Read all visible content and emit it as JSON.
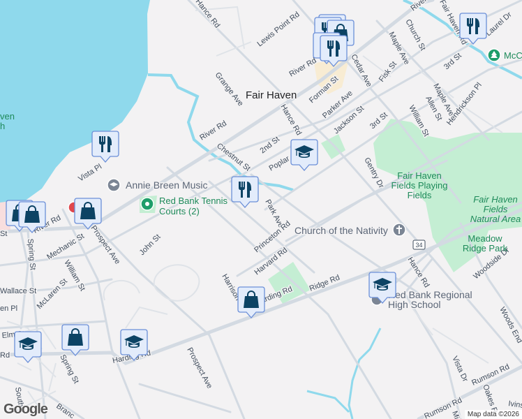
{
  "map": {
    "colors": {
      "water": "#8fd9ec",
      "park": "#c4eed3",
      "land": "#f3f2f3",
      "road": "#d3dae2",
      "marker_bg": "#e3ecfb",
      "marker_border": "#6b8fd8",
      "marker_icon": "#0c4364",
      "commercial": "#f8ecd3"
    },
    "town_label": "Fair Haven",
    "streets": {
      "hance_rd_n": "Hance Rd",
      "lewis_point": "Lewis Point Rd",
      "river_top": "River Rd",
      "fair_haven_rd": "Fair Haven Rd",
      "church": "Church St",
      "laurel": "Laurel Dr",
      "grange": "Grange Ave",
      "river_mid": "River Rd",
      "cedar": "Cedar Ave",
      "fisk": "Fisk St",
      "maple_n": "Maple Ave",
      "third_n": "3rd St",
      "forman": "Forman St",
      "maple_s": "Maple Ave",
      "allen": "Allen St",
      "hendrickson": "Hendrickson Pl",
      "parker": "Parker Ave",
      "hance_mid": "Hance Rd",
      "jackson": "Jackson St",
      "third_s": "3rd St",
      "william_e": "William St",
      "river_w": "River Rd",
      "chestnut": "Chestnut St",
      "second": "2nd St",
      "poplar": "Poplar",
      "gentry": "Gentry Dr",
      "vista_pl": "Vista Pl",
      "park_ave": "Park Ave",
      "princeton": "Princeton Rd",
      "harvard": "Harvard Rd",
      "harrison": "Harrison",
      "river_sw": "River Rd",
      "prospect_n": "Prospect Ave",
      "john": "John St",
      "mechanic": "Mechanic St",
      "spring_n": "Spring St",
      "william_w": "William St",
      "wallace": "Wallace St",
      "mclaren": "McLaren St",
      "pl": "en Pl",
      "elm": "Elm St",
      "harding_w": "Rd",
      "harding": "Harding Rd",
      "spring_s": "Spring St",
      "prospect_s": "Prospect Ave",
      "south": "South",
      "branch": "Branc",
      "ridge": "Ridge Rd",
      "harding_e": "Harding Rd",
      "hance_s": "Hance Rd",
      "woodside": "Woodside Dr",
      "woods_end": "Woods End",
      "vista_dr": "Vista Dr",
      "rumson_e": "Rumson Rd",
      "rumson_w": "Rumson Rd",
      "oakes": "Oakes R",
      "ivins": "Ivins",
      "mi": "Mi",
      "st_w": "St"
    },
    "route_shield": "34",
    "pois": {
      "annie_breen": "Annie Breen Music",
      "tennis_1": "Red Bank Tennis",
      "tennis_2": "Courts (2)",
      "church": "Church of the Nativity",
      "fields_1": "Fair Haven",
      "fields_2": "Fields Playing",
      "fields_3": "Fields",
      "natural_1": "Fair Haven",
      "natural_2": "Fields",
      "natural_3": "Natural Area",
      "meadow_1": "Meadow",
      "meadow_2": "Ridge Park",
      "rbr_1": "Red Bank Regional",
      "rbr_2": "High School",
      "mcc": "McC",
      "beach_1": "ven",
      "beach_2": "h"
    },
    "markers": [
      {
        "type": "restaurant",
        "icon": "fork-knife-icon"
      },
      {
        "type": "restaurant",
        "icon": "fork-knife-icon"
      },
      {
        "type": "restaurant",
        "icon": "fork-knife-icon"
      },
      {
        "type": "restaurant-cluster",
        "icon": "fork-knife-icon"
      },
      {
        "type": "shopping",
        "icon": "shopping-bag-icon"
      },
      {
        "type": "education",
        "icon": "graduation-cap-icon"
      }
    ],
    "attribution": "Map data ©2026",
    "logo": "Google"
  }
}
